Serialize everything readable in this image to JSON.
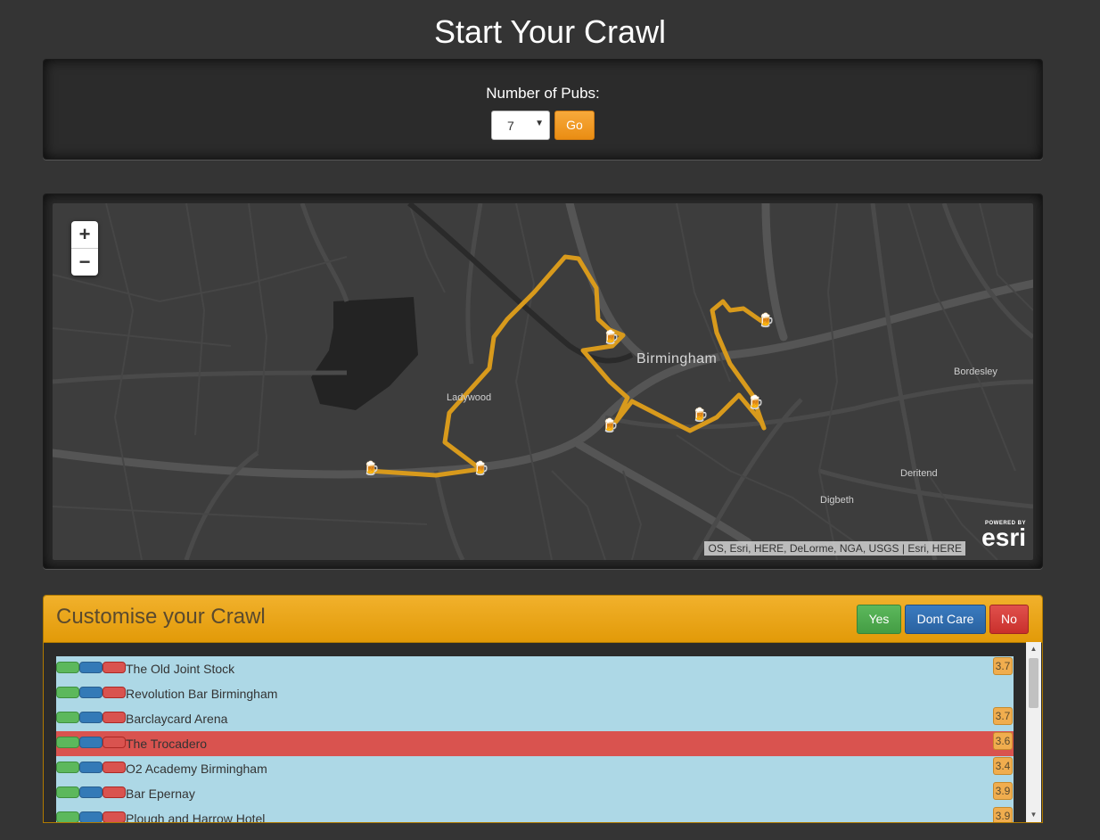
{
  "page": {
    "title": "Start Your Crawl"
  },
  "pubs_selector": {
    "label": "Number of Pubs:",
    "selected": "7",
    "go_label": "Go"
  },
  "map": {
    "zoom_in": "+",
    "zoom_out": "−",
    "labels": {
      "city": "Birmingham",
      "ladywood": "Ladywood",
      "bordesley": "Bordesley",
      "deritend": "Deritend",
      "digbeth": "Digbeth"
    },
    "attribution": "OS, Esri, HERE, DeLorme, NGA, USGS | Esri, HERE",
    "logo": {
      "powered": "POWERED BY",
      "brand": "esri"
    },
    "route_color": "#d89a1c",
    "pub_marker_icon": "beer-mug-icon",
    "pub_marker_glyph": "🍺"
  },
  "customise": {
    "title": "Customise your Crawl",
    "yes_label": "Yes",
    "dontcare_label": "Dont Care",
    "no_label": "No",
    "pubs": [
      {
        "name": "The Old Joint Stock",
        "rating": "3.7",
        "excluded": false
      },
      {
        "name": "Revolution Bar Birmingham",
        "rating": "",
        "excluded": false
      },
      {
        "name": "Barclaycard Arena",
        "rating": "3.7",
        "excluded": false
      },
      {
        "name": "The Trocadero",
        "rating": "3.6",
        "excluded": true
      },
      {
        "name": "O2 Academy Birmingham",
        "rating": "3.4",
        "excluded": false
      },
      {
        "name": "Bar Epernay",
        "rating": "3.9",
        "excluded": false
      },
      {
        "name": "Plough and Harrow Hotel",
        "rating": "3.9",
        "excluded": false
      }
    ]
  },
  "colors": {
    "background": "#343434",
    "accent": "#f0ad4e",
    "row_default": "#add8e6",
    "row_excluded": "#d9534f"
  }
}
